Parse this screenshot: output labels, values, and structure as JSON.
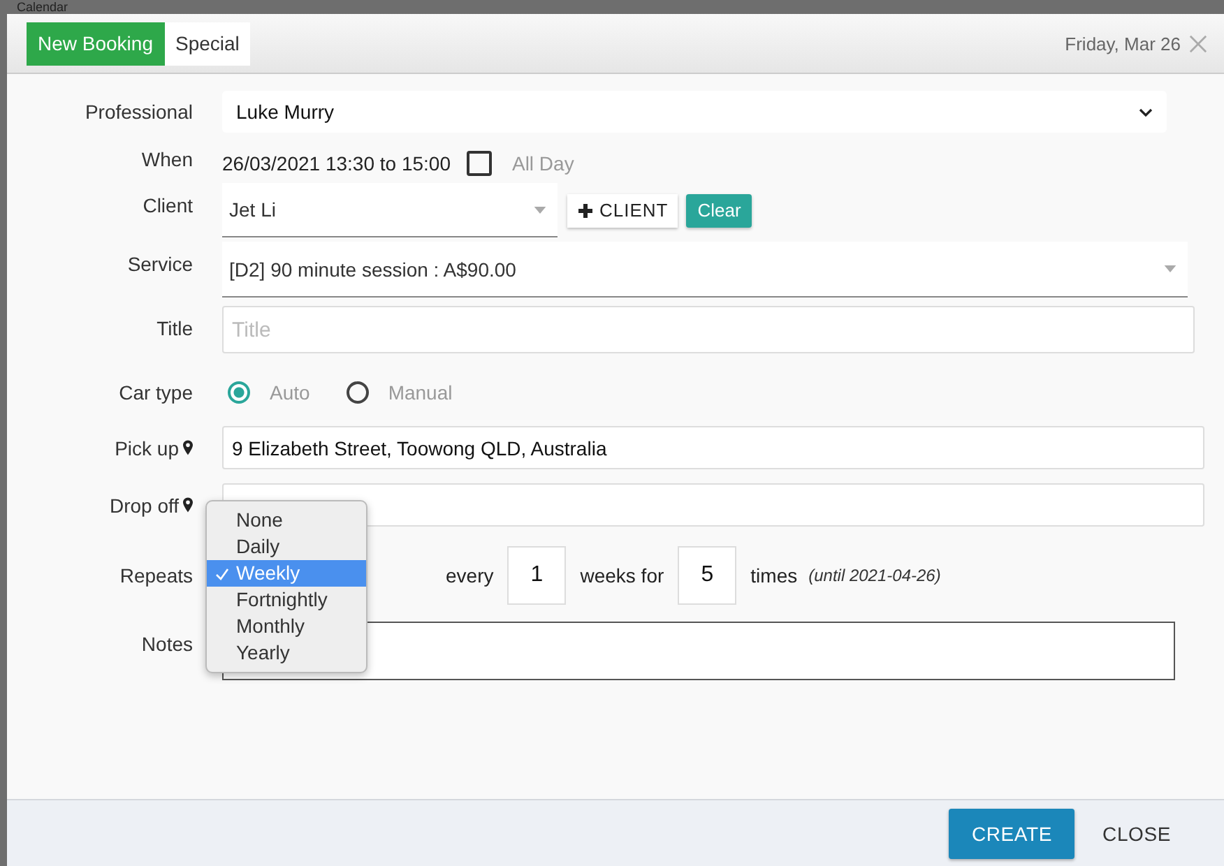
{
  "background": {
    "title": "Calendar"
  },
  "tabs": [
    {
      "label": "New Booking",
      "selected": true
    },
    {
      "label": "Special",
      "selected": false
    }
  ],
  "header": {
    "date": "Friday, Mar 26"
  },
  "form": {
    "professional": {
      "label": "Professional",
      "value": "Luke Murry"
    },
    "when": {
      "label": "When",
      "value": "26/03/2021 13:30 to 15:00",
      "all_day": {
        "label": "All Day",
        "checked": false
      }
    },
    "client": {
      "label": "Client",
      "value": "Jet Li",
      "add_button": "CLIENT",
      "clear_button": "Clear"
    },
    "service": {
      "label": "Service",
      "value": "[D2] 90 minute session : A$90.00"
    },
    "title": {
      "label": "Title",
      "placeholder": "Title"
    },
    "car_type": {
      "label": "Car type",
      "options": [
        {
          "label": "Auto",
          "selected": true
        },
        {
          "label": "Manual",
          "selected": false
        }
      ]
    },
    "pick_up": {
      "label": "Pick up",
      "value": "9 Elizabeth Street, Toowong QLD, Australia"
    },
    "drop_off": {
      "label": "Drop off"
    },
    "repeats": {
      "label": "Repeats",
      "every_label": "every",
      "every_value": "1",
      "unit_label": "weeks for",
      "times_value": "5",
      "times_label": "times",
      "until": "(until 2021-04-26)",
      "menu": [
        {
          "label": "None",
          "selected": false
        },
        {
          "label": "Daily",
          "selected": false
        },
        {
          "label": "Weekly",
          "selected": true
        },
        {
          "label": "Fortnightly",
          "selected": false
        },
        {
          "label": "Monthly",
          "selected": false
        },
        {
          "label": "Yearly",
          "selected": false
        }
      ]
    },
    "notes": {
      "label": "Notes"
    }
  },
  "footer": {
    "buttons": [
      "CREATE",
      "CLOSE"
    ]
  }
}
